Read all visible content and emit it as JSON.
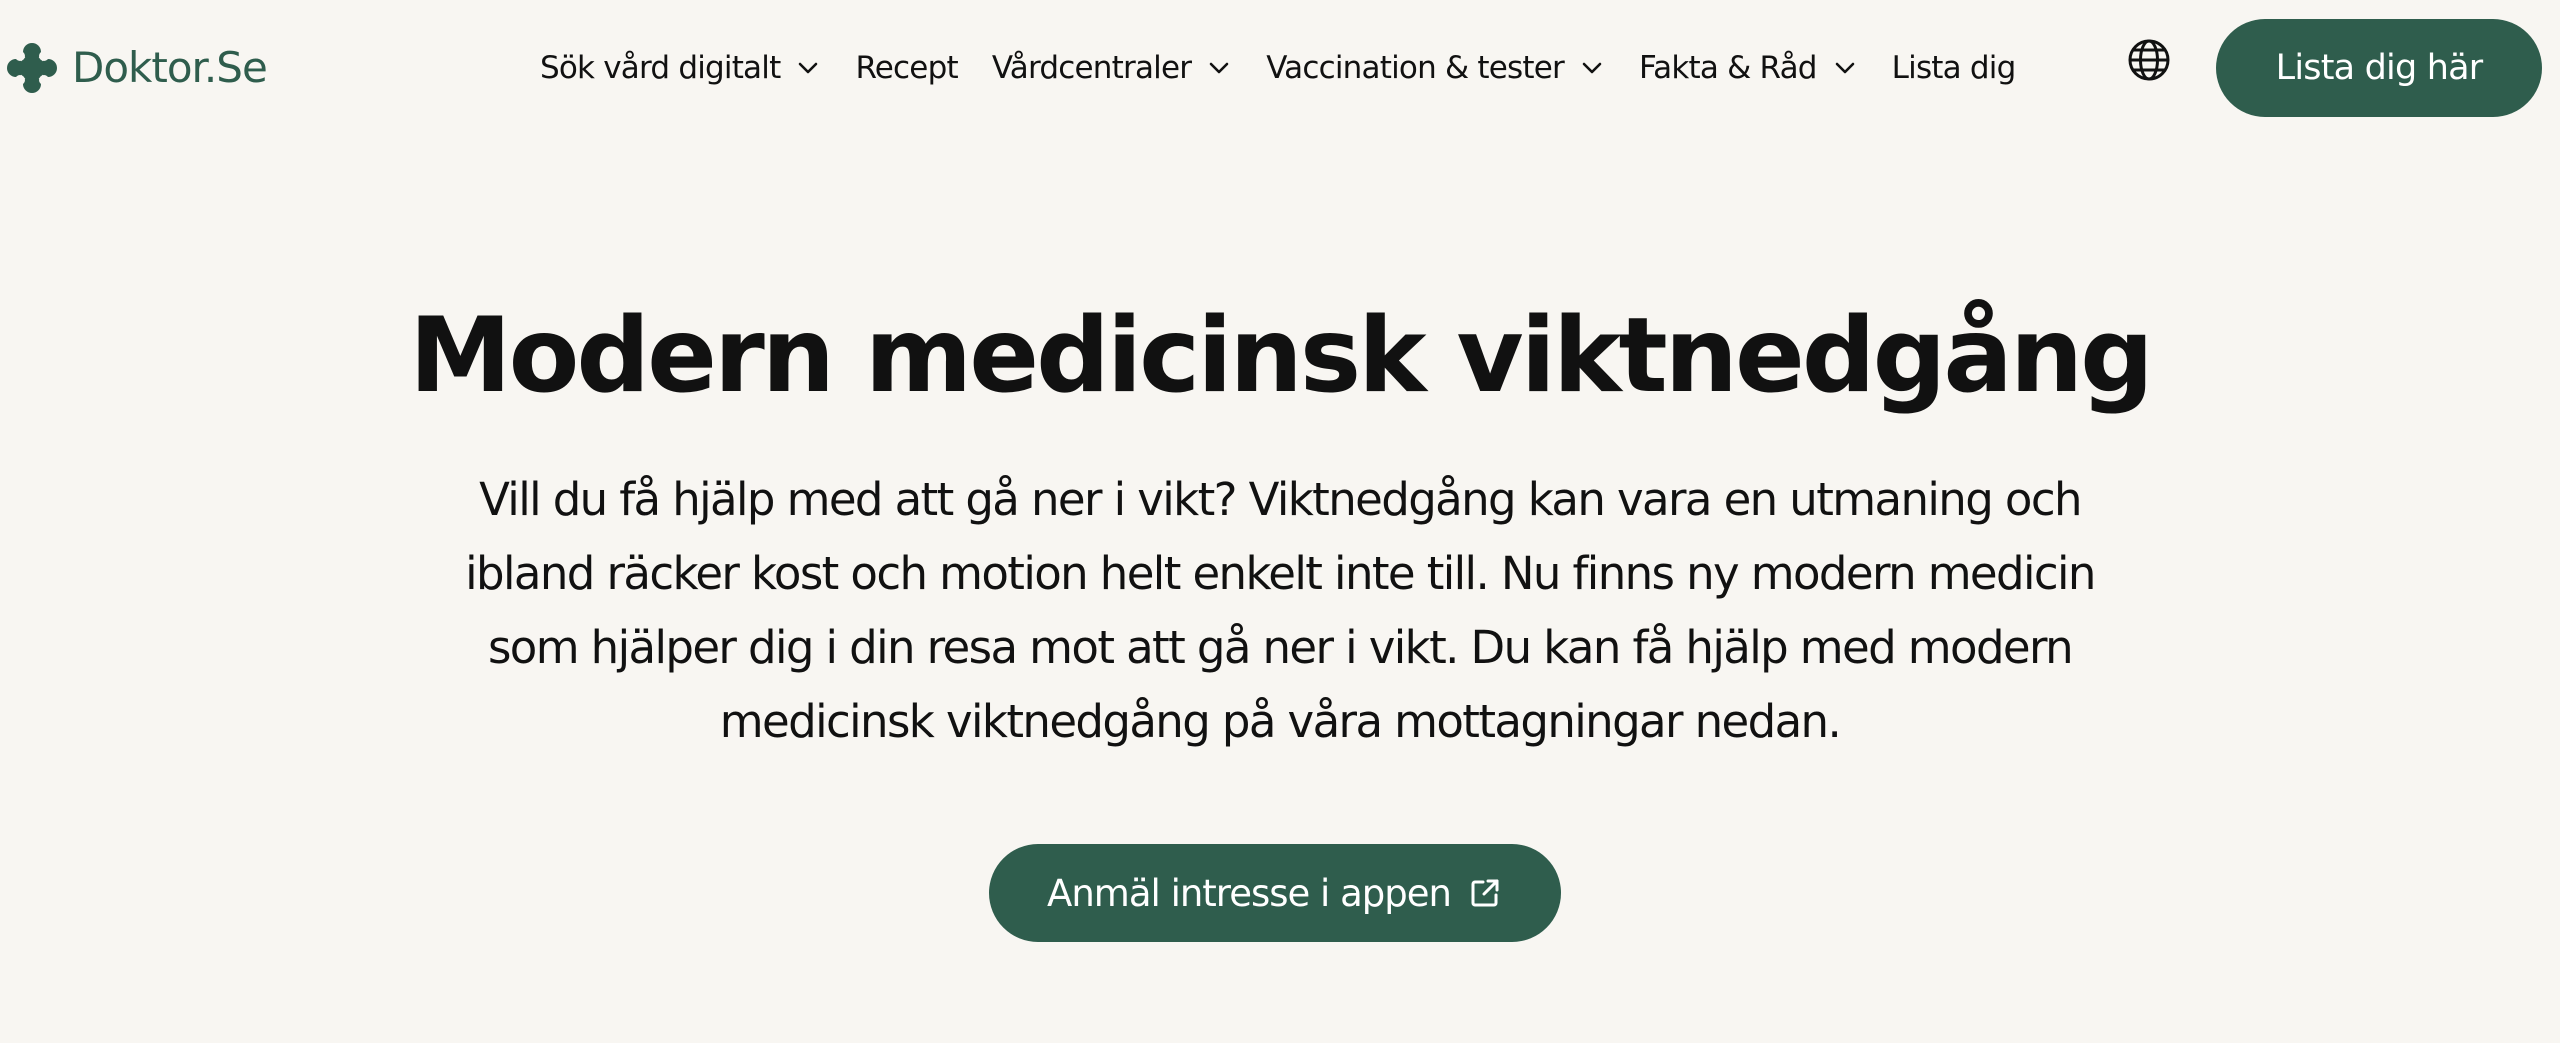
{
  "brand": {
    "name": "Doktor.Se",
    "logo_icon": "clover-logo-icon",
    "color": "#2f5d4d"
  },
  "nav": {
    "items": [
      {
        "label": "Sök vård digitalt",
        "has_dropdown": true
      },
      {
        "label": "Recept",
        "has_dropdown": false
      },
      {
        "label": "Vårdcentraler",
        "has_dropdown": true
      },
      {
        "label": "Vaccination & tester",
        "has_dropdown": true
      },
      {
        "label": "Fakta & Råd",
        "has_dropdown": true
      },
      {
        "label": "Lista dig",
        "has_dropdown": false
      }
    ],
    "language_icon": "globe-icon",
    "cta_label": "Lista dig här"
  },
  "hero": {
    "title": "Modern medicinsk viktnedgång",
    "description": "Vill du få hjälp med att gå ner i vikt? Viktnedgång kan vara en utmaning och ibland räcker kost och motion helt enkelt inte till. Nu finns ny modern medicin som hjälper dig i din resa mot att gå ner i vikt. Du kan få hjälp med modern medicinsk viktnedgång på våra mottagningar nedan.",
    "cta_label": "Anmäl intresse i appen",
    "cta_icon": "external-link-icon"
  },
  "colors": {
    "background": "#f8f6f2",
    "accent": "#2f5d4d",
    "text": "#111111"
  }
}
